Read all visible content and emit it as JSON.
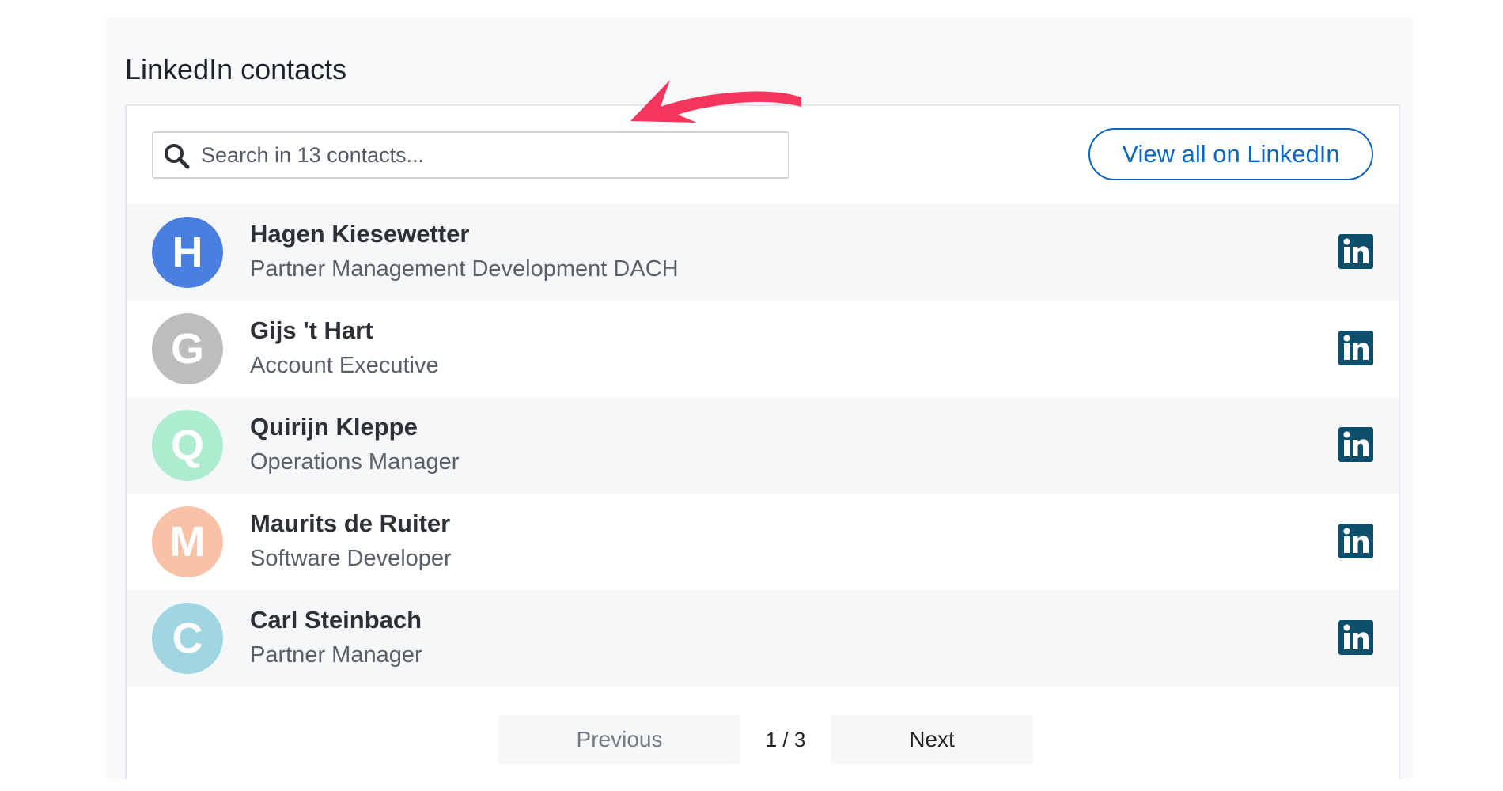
{
  "panel": {
    "title": "LinkedIn contacts"
  },
  "search": {
    "placeholder": "Search in 13 contacts..."
  },
  "actions": {
    "view_all_label": "View all on LinkedIn"
  },
  "contacts": [
    {
      "initial": "H",
      "name": "Hagen Kiesewetter",
      "role": "Partner Management Development DACH",
      "avatar_color": "#4a7fe0"
    },
    {
      "initial": "G",
      "name": "Gijs 't Hart",
      "role": "Account Executive",
      "avatar_color": "#bdbdbd"
    },
    {
      "initial": "Q",
      "name": "Quirijn Kleppe",
      "role": "Operations Manager",
      "avatar_color": "#aeeccf"
    },
    {
      "initial": "M",
      "name": "Maurits de Ruiter",
      "role": "Software Developer",
      "avatar_color": "#f8c2a6"
    },
    {
      "initial": "C",
      "name": "Carl Steinbach",
      "role": "Partner Manager",
      "avatar_color": "#9fd6e2"
    }
  ],
  "pagination": {
    "previous_label": "Previous",
    "page_indicator": "1 / 3",
    "next_label": "Next"
  },
  "colors": {
    "linkedin_brand": "#0a66c2",
    "linkedin_icon": "#0b4f6c",
    "arrow_annotation": "#f5365c"
  },
  "icons": {
    "search": "search-icon",
    "linkedin": "linkedin-icon",
    "annotation": "arrow-annotation"
  }
}
